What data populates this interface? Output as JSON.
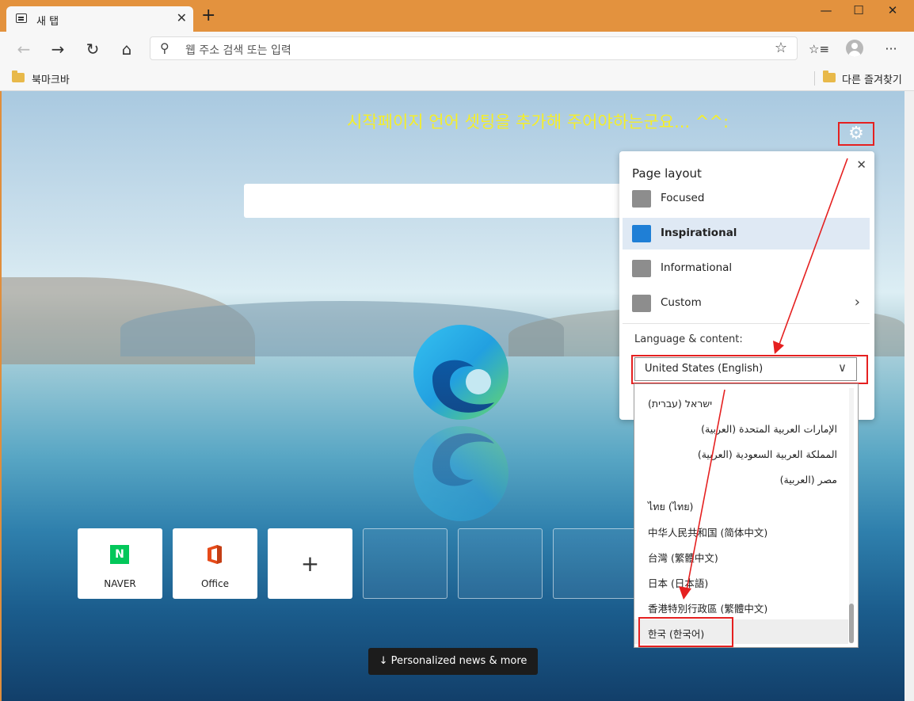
{
  "tab": {
    "title": "새 탭",
    "close": "✕",
    "new_tab": "+"
  },
  "window_controls": {
    "minimize": "—",
    "maximize": "☐",
    "close": "✕"
  },
  "toolbar": {
    "back": "←",
    "forward": "→",
    "refresh": "↻",
    "home": "⌂",
    "address_placeholder": "웹 주소 검색 또는 입력",
    "favorite": "☆",
    "collections": "☆≡",
    "menu": "···"
  },
  "bookmarks": {
    "bar_label": "북마크바",
    "other_label": "다른 즐겨찾기"
  },
  "annotation": "시작페이지 언어 셋팅을 추가해 주어야하는군요... ^^:",
  "settings_icon": "⚙",
  "tiles": [
    {
      "label": "NAVER",
      "icon": "N"
    },
    {
      "label": "Office",
      "icon": "office-icon"
    },
    {
      "label": "",
      "icon": "+"
    }
  ],
  "news_button": "↓  Personalized news & more",
  "panel": {
    "title": "Page layout",
    "close": "✕",
    "layouts": [
      {
        "label": "Focused",
        "selected": false
      },
      {
        "label": "Inspirational",
        "selected": true
      },
      {
        "label": "Informational",
        "selected": false
      },
      {
        "label": "Custom",
        "selected": false,
        "chevron": "›"
      }
    ],
    "language_label": "Language & content:",
    "language_value": "United States (English)",
    "chevron": "∨"
  },
  "dropdown_options": [
    "ישראל (עברית)",
    "الإمارات العربية المتحدة (العربية)",
    "المملكة العربية السعودية (العربية)",
    "مصر (العربية)",
    "ไทย (ไทย)",
    "中华人民共和国 (简体中文)",
    "台灣 (繁體中文)",
    "日本 (日本語)",
    "香港特別行政區 (繁體中文)",
    "한국 (한국어)"
  ],
  "colors": {
    "annotation": "#f5ee2a",
    "highlight_box": "#e52020",
    "title_bar": "#e3923e",
    "selection": "#dfe9f4"
  }
}
